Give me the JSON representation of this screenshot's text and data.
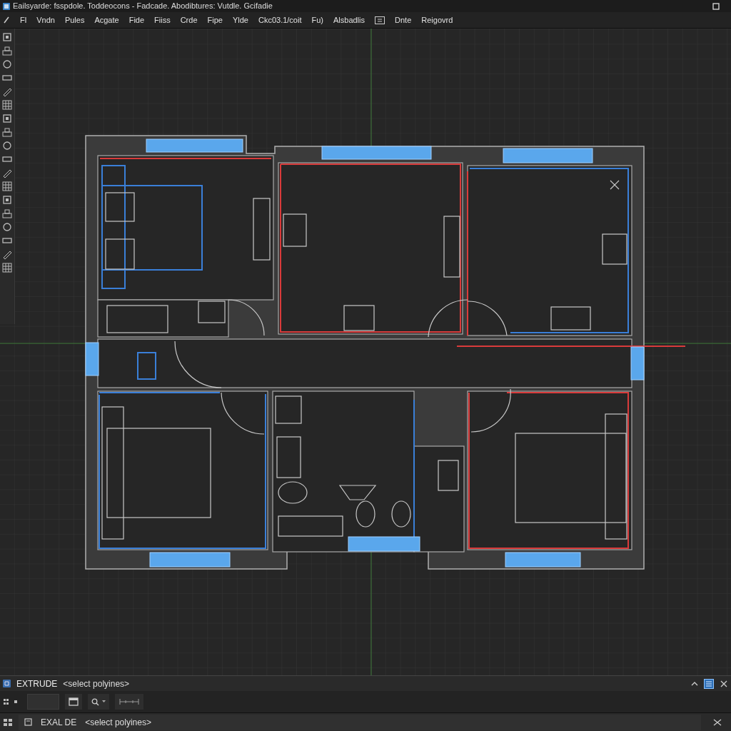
{
  "window": {
    "title": "Eailsyarde: fsspdole. Toddeocons - Fadcade. Abodibtures: Vutdle. Gcifadie"
  },
  "menu": {
    "items": [
      "Fl",
      "Vndn",
      "Pules",
      "Acgate",
      "Fide",
      "Fiiss",
      "Crde",
      "Fipe",
      "Ylde",
      "Ckc03.1/coit",
      "Fu)",
      "Alsbadlis",
      "Dnte",
      "Reigovrd"
    ]
  },
  "command_line": {
    "command": "EXTRUDE",
    "prompt": "<select polyines>"
  },
  "status_line": {
    "command": "EXAL DE",
    "prompt": "<select polyines>"
  }
}
